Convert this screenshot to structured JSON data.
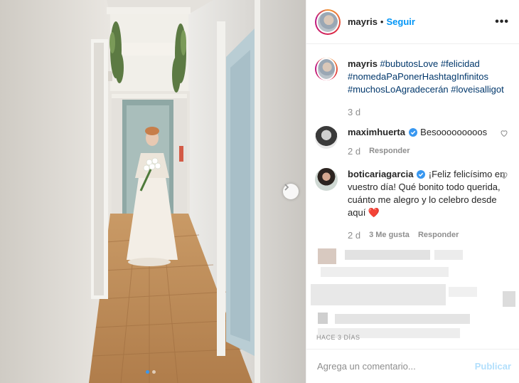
{
  "post": {
    "author": "mayris",
    "separator": "•",
    "follow_label": "Seguir",
    "more_label": "•••",
    "carousel": {
      "slides": 2,
      "active": 1
    }
  },
  "caption": {
    "user": "mayris",
    "hashtags": [
      "#bubutosLove",
      "#felicidad",
      "#nomedaPaPonerHashtagInfinitos",
      "#muchosLoAgradecerán",
      "#loveisalligot"
    ],
    "time": "3 d"
  },
  "comments": [
    {
      "user": "maximhuerta",
      "verified": true,
      "text": "Besooooooooos",
      "time": "2 d",
      "reply_label": "Responder"
    },
    {
      "user": "boticariagarcia",
      "verified": true,
      "text": "¡Feliz felicísimo en vuestro día! Qué bonito todo querida, cuánto me alegro y lo celebro desde aquí ❤️",
      "time": "2 d",
      "likes_label": "3 Me gusta",
      "reply_label": "Responder"
    }
  ],
  "timestamp": "HACE 3 DÍAS",
  "add_comment": {
    "placeholder": "Agrega un comentario...",
    "publish_label": "Publicar"
  },
  "colors": {
    "link": "#0095f6",
    "hashtag": "#00376b",
    "verified": "#3897f0",
    "heart": "#ed4956"
  },
  "icons": [
    "more-options-icon",
    "verified-icon",
    "heart-icon",
    "chevron-right-icon"
  ]
}
